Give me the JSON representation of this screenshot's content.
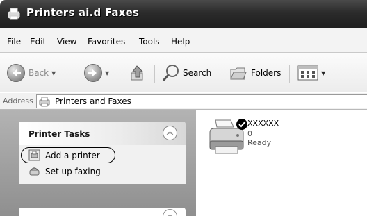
{
  "window": {
    "title": "Printers ai.d Faxes"
  },
  "menu": [
    "File",
    "Edit",
    "View",
    "Favorites",
    "Tools",
    "Help"
  ],
  "toolbar": {
    "back_label": "Back",
    "search_label": "Search",
    "folders_label": "Folders"
  },
  "address": {
    "label": "Address",
    "value": "Printers and Faxes"
  },
  "tasks": {
    "title": "Printer Tasks",
    "items": [
      {
        "label": "Add a printer",
        "icon": "add-printer-icon"
      },
      {
        "label": "Set up faxing",
        "icon": "fax-icon"
      }
    ]
  },
  "printer": {
    "name": "XXXXXX",
    "jobs": "0",
    "status": "Ready",
    "default": true
  }
}
